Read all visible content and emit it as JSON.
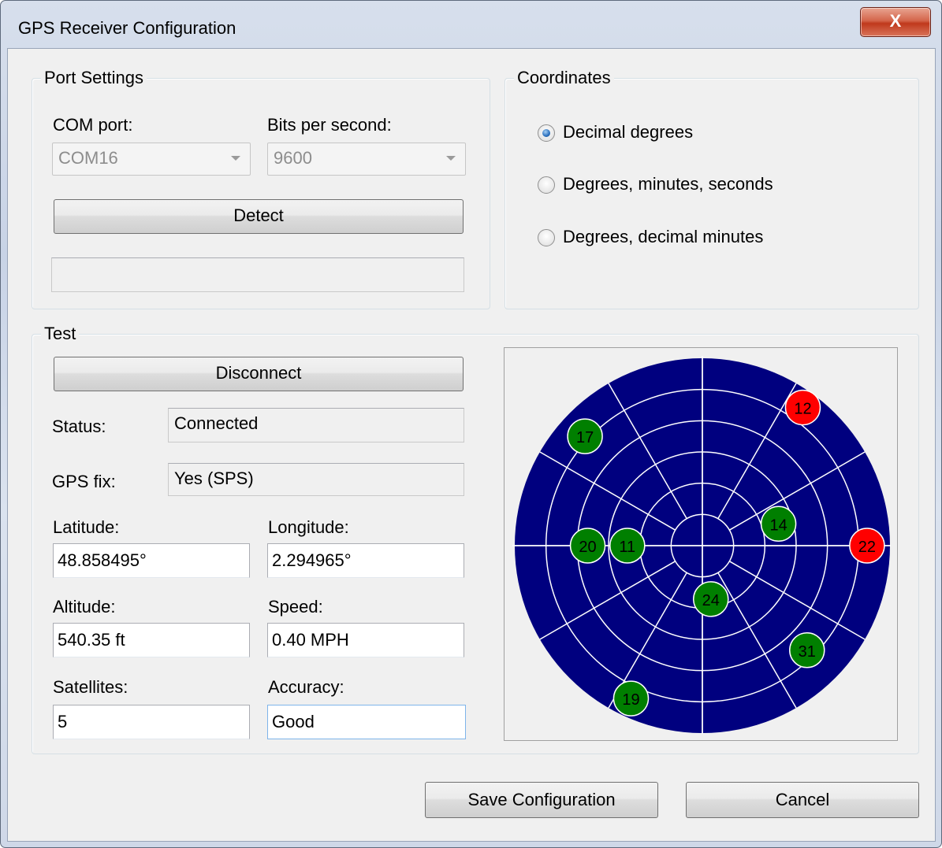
{
  "window": {
    "title": "GPS Receiver Configuration",
    "close_label": "X"
  },
  "port_settings": {
    "group_label": "Port Settings",
    "com_port_label": "COM port:",
    "com_port_value": "COM16",
    "bits_label": "Bits per second:",
    "bits_value": "9600",
    "detect_label": "Detect",
    "detect_status": ""
  },
  "coordinates": {
    "group_label": "Coordinates",
    "options": [
      {
        "label": "Decimal degrees",
        "checked": true
      },
      {
        "label": "Degrees, minutes, seconds",
        "checked": false
      },
      {
        "label": "Degrees, decimal minutes",
        "checked": false
      }
    ]
  },
  "test": {
    "group_label": "Test",
    "disconnect_label": "Disconnect",
    "status_label": "Status:",
    "status_value": "Connected",
    "fix_label": "GPS fix:",
    "fix_value": "Yes (SPS)",
    "latitude_label": "Latitude:",
    "latitude_value": "48.858495°",
    "longitude_label": "Longitude:",
    "longitude_value": "2.294965°",
    "altitude_label": "Altitude:",
    "altitude_value": "540.35 ft",
    "speed_label": "Speed:",
    "speed_value": "0.40 MPH",
    "satellites_label": "Satellites:",
    "satellites_value": "5",
    "accuracy_label": "Accuracy:",
    "accuracy_value": "Good"
  },
  "skyplot": {
    "colors": {
      "sky": "#00007f",
      "grid": "#ffffff",
      "used": "#007f00",
      "unused": "#ff0000"
    },
    "satellites": [
      {
        "id": "12",
        "azimuth": 36,
        "elevation": 8,
        "used": false
      },
      {
        "id": "17",
        "azimuth": 313,
        "elevation": 13,
        "used": true
      },
      {
        "id": "14",
        "azimuth": 74,
        "elevation": 52,
        "used": true
      },
      {
        "id": "22",
        "azimuth": 90,
        "elevation": 11,
        "used": false
      },
      {
        "id": "20",
        "azimuth": 270,
        "elevation": 35,
        "used": true
      },
      {
        "id": "11",
        "azimuth": 270,
        "elevation": 54,
        "used": true
      },
      {
        "id": "24",
        "azimuth": 171,
        "elevation": 64,
        "used": true
      },
      {
        "id": "31",
        "azimuth": 135,
        "elevation": 19,
        "used": true
      },
      {
        "id": "19",
        "azimuth": 205,
        "elevation": 9,
        "used": true
      }
    ]
  },
  "footer": {
    "save_label": "Save Configuration",
    "cancel_label": "Cancel"
  }
}
